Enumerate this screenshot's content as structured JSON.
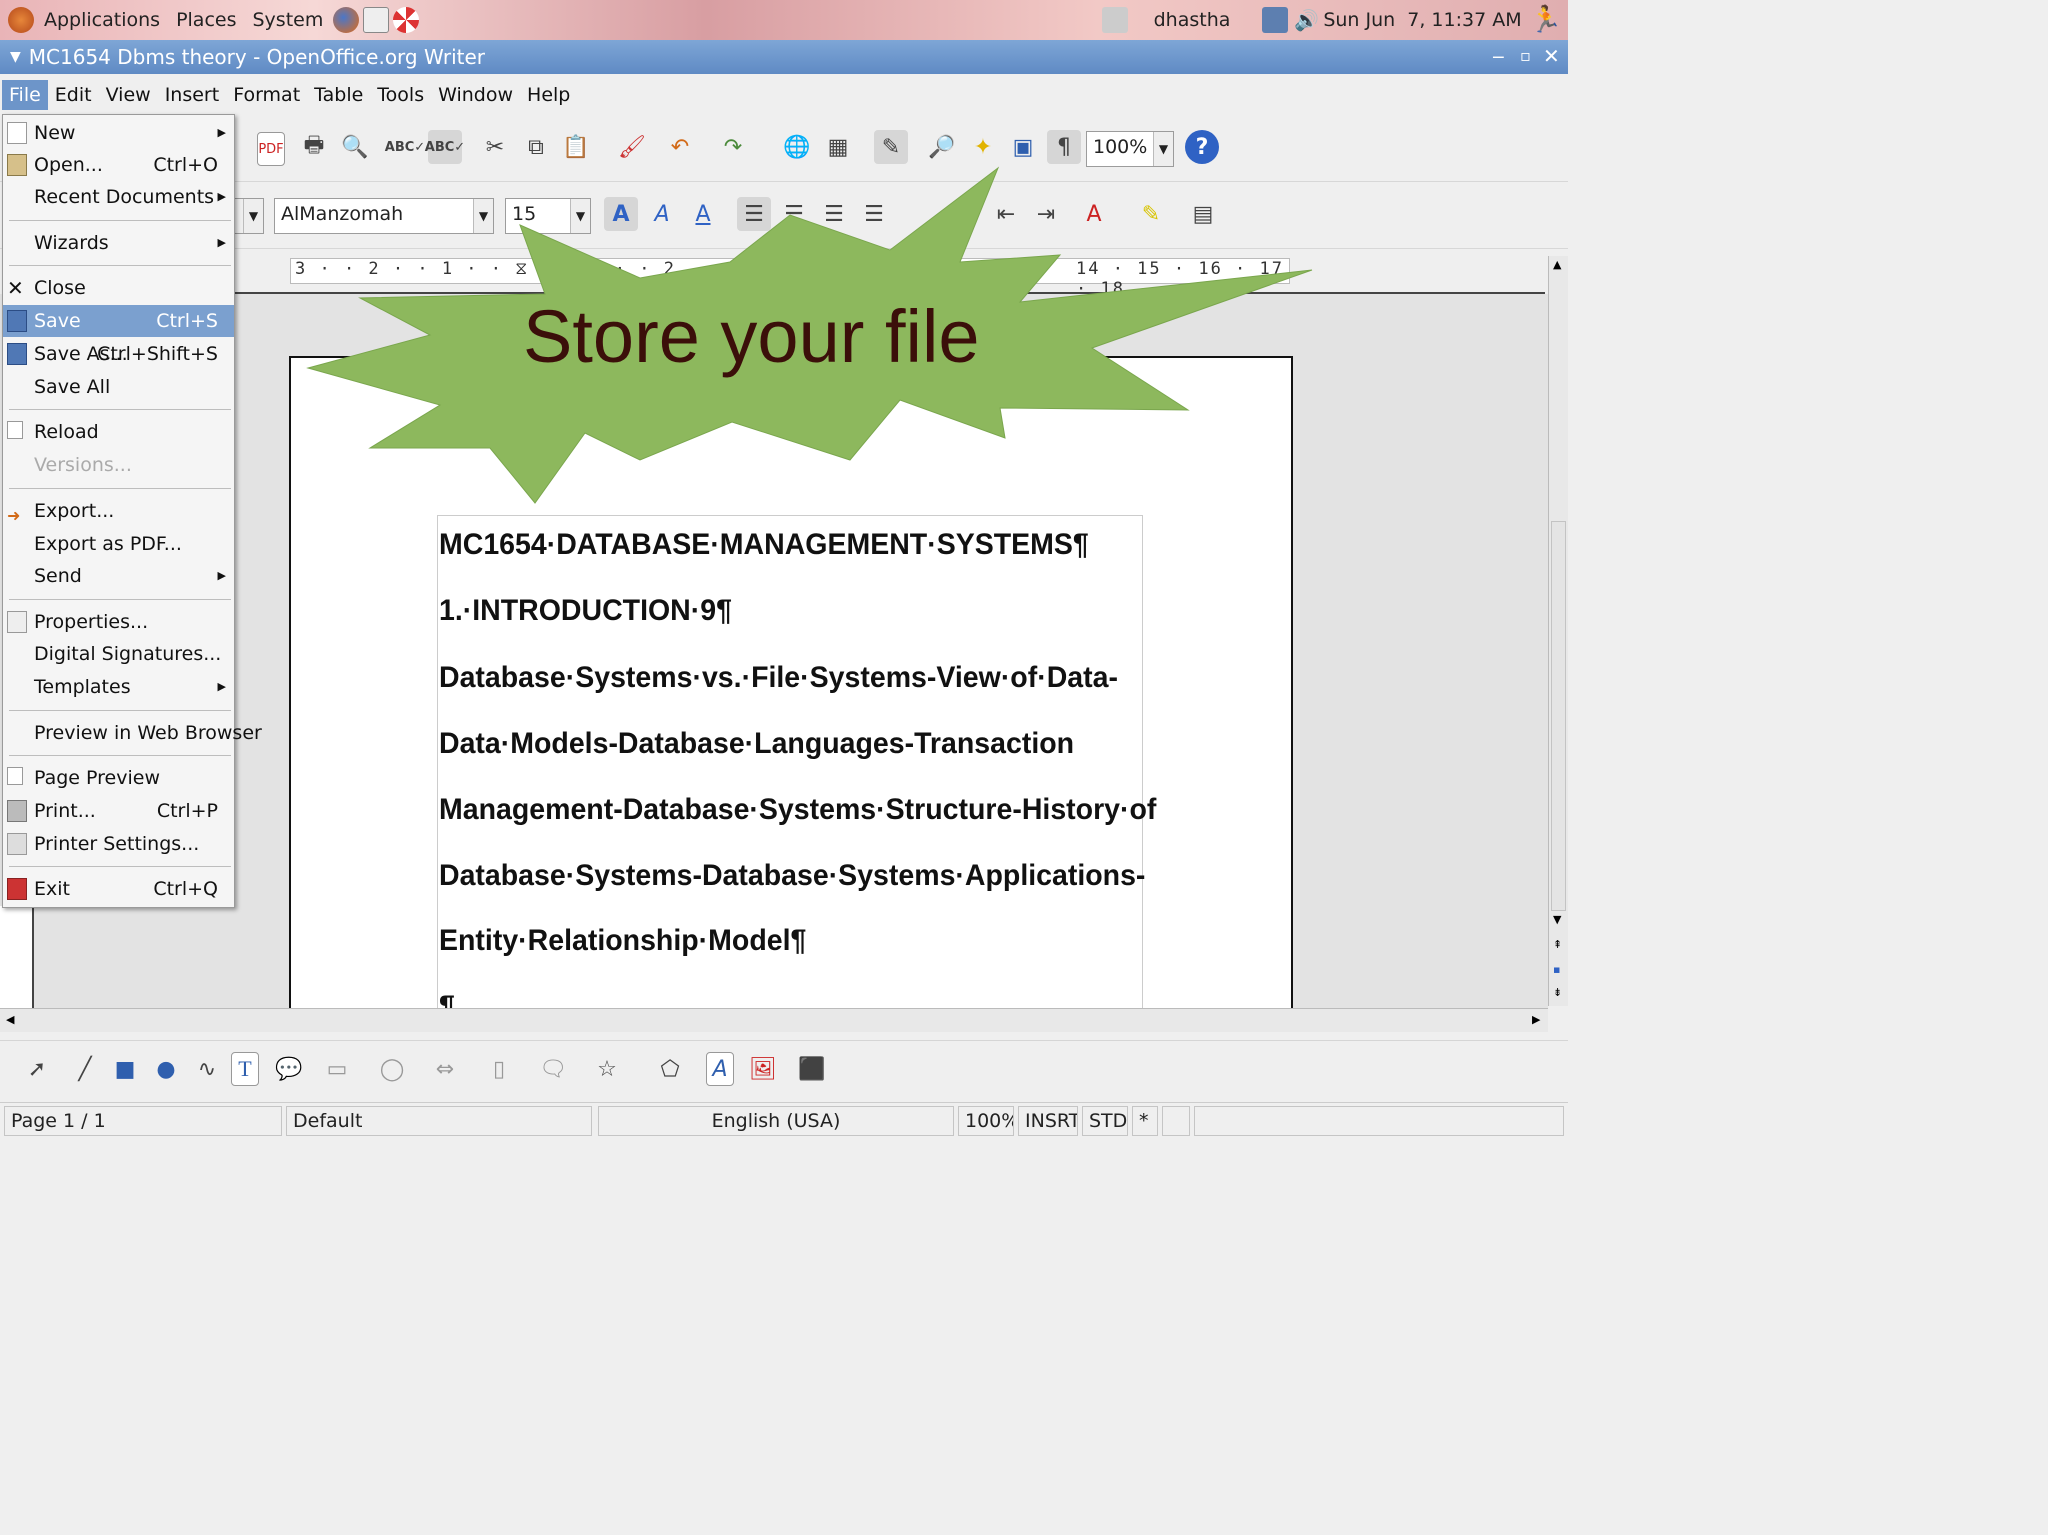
{
  "top_panel": {
    "menus": [
      "Applications",
      "Places",
      "System"
    ],
    "user": "dhastha",
    "clock": "Sun Jun  7, 11:37 AM"
  },
  "window": {
    "title": "MC1654 Dbms theory - OpenOffice.org Writer"
  },
  "menubar": {
    "items": [
      "File",
      "Edit",
      "View",
      "Insert",
      "Format",
      "Table",
      "Tools",
      "Window",
      "Help"
    ],
    "active": "File"
  },
  "toolbar": {
    "zoom": "100%"
  },
  "format_toolbar": {
    "font_name": "AlManzomah",
    "font_size": "15"
  },
  "ruler": {
    "left_ticks": "3 · · 2 · · 1 · · ⧖ · · 1 · · 2",
    "right_ticks": "14 · 15 · 16 · 17 · 18"
  },
  "file_menu": {
    "items": [
      {
        "label": "New",
        "shortcut": "",
        "submenu": true
      },
      {
        "label": "Open...",
        "shortcut": "Ctrl+O",
        "submenu": false
      },
      {
        "label": "Recent Documents",
        "shortcut": "",
        "submenu": true
      },
      {
        "label": "Wizards",
        "shortcut": "",
        "submenu": true
      },
      {
        "label": "Close",
        "shortcut": "",
        "submenu": false
      },
      {
        "label": "Save",
        "shortcut": "Ctrl+S",
        "submenu": false
      },
      {
        "label": "Save As...",
        "shortcut": "Ctrl+Shift+S",
        "submenu": false
      },
      {
        "label": "Save All",
        "shortcut": "",
        "submenu": false
      },
      {
        "label": "Reload",
        "shortcut": "",
        "submenu": false
      },
      {
        "label": "Versions...",
        "shortcut": "",
        "submenu": false
      },
      {
        "label": "Export...",
        "shortcut": "",
        "submenu": false
      },
      {
        "label": "Export as PDF...",
        "shortcut": "",
        "submenu": false
      },
      {
        "label": "Send",
        "shortcut": "",
        "submenu": true
      },
      {
        "label": "Properties...",
        "shortcut": "",
        "submenu": false
      },
      {
        "label": "Digital Signatures...",
        "shortcut": "",
        "submenu": false
      },
      {
        "label": "Templates",
        "shortcut": "",
        "submenu": true
      },
      {
        "label": "Preview in Web Browser",
        "shortcut": "",
        "submenu": false
      },
      {
        "label": "Page Preview",
        "shortcut": "",
        "submenu": false
      },
      {
        "label": "Print...",
        "shortcut": "Ctrl+P",
        "submenu": false
      },
      {
        "label": "Printer Settings...",
        "shortcut": "",
        "submenu": false
      },
      {
        "label": "Exit",
        "shortcut": "Ctrl+Q",
        "submenu": false
      }
    ],
    "highlighted": "Save"
  },
  "callout": {
    "text": "Store your file",
    "fill": "#8db85d"
  },
  "document": {
    "lines": [
      "MC1654·DATABASE·MANAGEMENT·SYSTEMS¶",
      "1.·INTRODUCTION·9¶",
      "Database·Systems·vs.·File·Systems-View·of·Data-",
      "Data·Models-Database·Languages-Transaction",
      "Management-Database·Systems·Structure-History·of",
      "Database·Systems-Database·Systems·Applications-",
      "Entity·Relationship·Model¶",
      "¶"
    ]
  },
  "statusbar": {
    "page": "Page 1 / 1",
    "style": "Default",
    "language": "English (USA)",
    "zoom": "100%",
    "insert_mode": "INSRT",
    "selection_mode": "STD",
    "modified": "*"
  },
  "colors": {
    "title_bar": "#6b93cb",
    "highlight": "#7ba0cf",
    "callout_text": "#3b0f0a"
  }
}
